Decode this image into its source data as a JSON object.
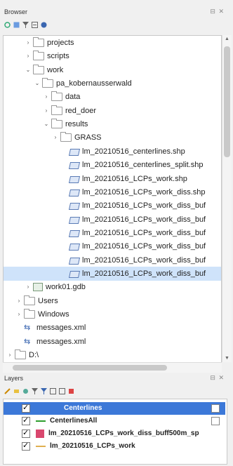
{
  "browser": {
    "title": "Browser",
    "controls": "⊟ ✕",
    "toolbar_icons": [
      "refresh-icon",
      "add-icon",
      "filter-icon",
      "collapse-icon",
      "info-icon"
    ],
    "items": [
      {
        "label": "projects",
        "level": 2,
        "arrow": "›",
        "icon": "folder"
      },
      {
        "label": "scripts",
        "level": 2,
        "arrow": "›",
        "icon": "folder"
      },
      {
        "label": "work",
        "level": 2,
        "arrow": "⌄",
        "icon": "folder"
      },
      {
        "label": "pa_kobernausserwald",
        "level": 3,
        "arrow": "⌄",
        "icon": "folder"
      },
      {
        "label": "data",
        "level": 4,
        "arrow": "›",
        "icon": "folder"
      },
      {
        "label": "red_doer",
        "level": 4,
        "arrow": "›",
        "icon": "folder"
      },
      {
        "label": "results",
        "level": 4,
        "arrow": "⌄",
        "icon": "folder"
      },
      {
        "label": "GRASS",
        "level": 5,
        "arrow": "›",
        "icon": "folder"
      },
      {
        "label": "lm_20210516_centerlines.shp",
        "level": 6,
        "arrow": "",
        "icon": "shp"
      },
      {
        "label": "lm_20210516_centerlines_split.shp",
        "level": 6,
        "arrow": "",
        "icon": "shp"
      },
      {
        "label": "lm_20210516_LCPs_work.shp",
        "level": 6,
        "arrow": "",
        "icon": "shp"
      },
      {
        "label": "lm_20210516_LCPs_work_diss.shp",
        "level": 6,
        "arrow": "",
        "icon": "shp"
      },
      {
        "label": "lm_20210516_LCPs_work_diss_buf",
        "level": 6,
        "arrow": "",
        "icon": "shp"
      },
      {
        "label": "lm_20210516_LCPs_work_diss_buf",
        "level": 6,
        "arrow": "",
        "icon": "shp"
      },
      {
        "label": "lm_20210516_LCPs_work_diss_buf",
        "level": 6,
        "arrow": "",
        "icon": "shp"
      },
      {
        "label": "lm_20210516_LCPs_work_diss_buf",
        "level": 6,
        "arrow": "",
        "icon": "shp"
      },
      {
        "label": "lm_20210516_LCPs_work_diss_buf",
        "level": 6,
        "arrow": "",
        "icon": "shp"
      },
      {
        "label": "lm_20210516_LCPs_work_diss_buf",
        "level": 6,
        "arrow": "",
        "icon": "shp",
        "selected": true
      },
      {
        "label": "work01.gdb",
        "level": 2,
        "arrow": "›",
        "icon": "gdb"
      },
      {
        "label": "Users",
        "level": 1,
        "arrow": "›",
        "icon": "folder"
      },
      {
        "label": "Windows",
        "level": 1,
        "arrow": "›",
        "icon": "folder"
      },
      {
        "label": "messages.xml",
        "level": 1,
        "arrow": "",
        "icon": "xml"
      },
      {
        "label": "messages.xml",
        "level": 1,
        "arrow": "",
        "icon": "xml"
      },
      {
        "label": "D:\\",
        "level": 0,
        "arrow": "›",
        "icon": "folder"
      }
    ]
  },
  "layers": {
    "title": "Layers",
    "controls": "⊟ ✕",
    "items": [
      {
        "label": "Centerlines",
        "symbol": "group",
        "selected": true
      },
      {
        "label": "CenterlinesAll",
        "symbol": "line-green"
      },
      {
        "label": "lm_20210516_LCPs_work_diss_buff500m_sp",
        "symbol": "fill-pink"
      },
      {
        "label": "lm_20210516_LCPs_work",
        "symbol": "line-yellow"
      }
    ]
  }
}
